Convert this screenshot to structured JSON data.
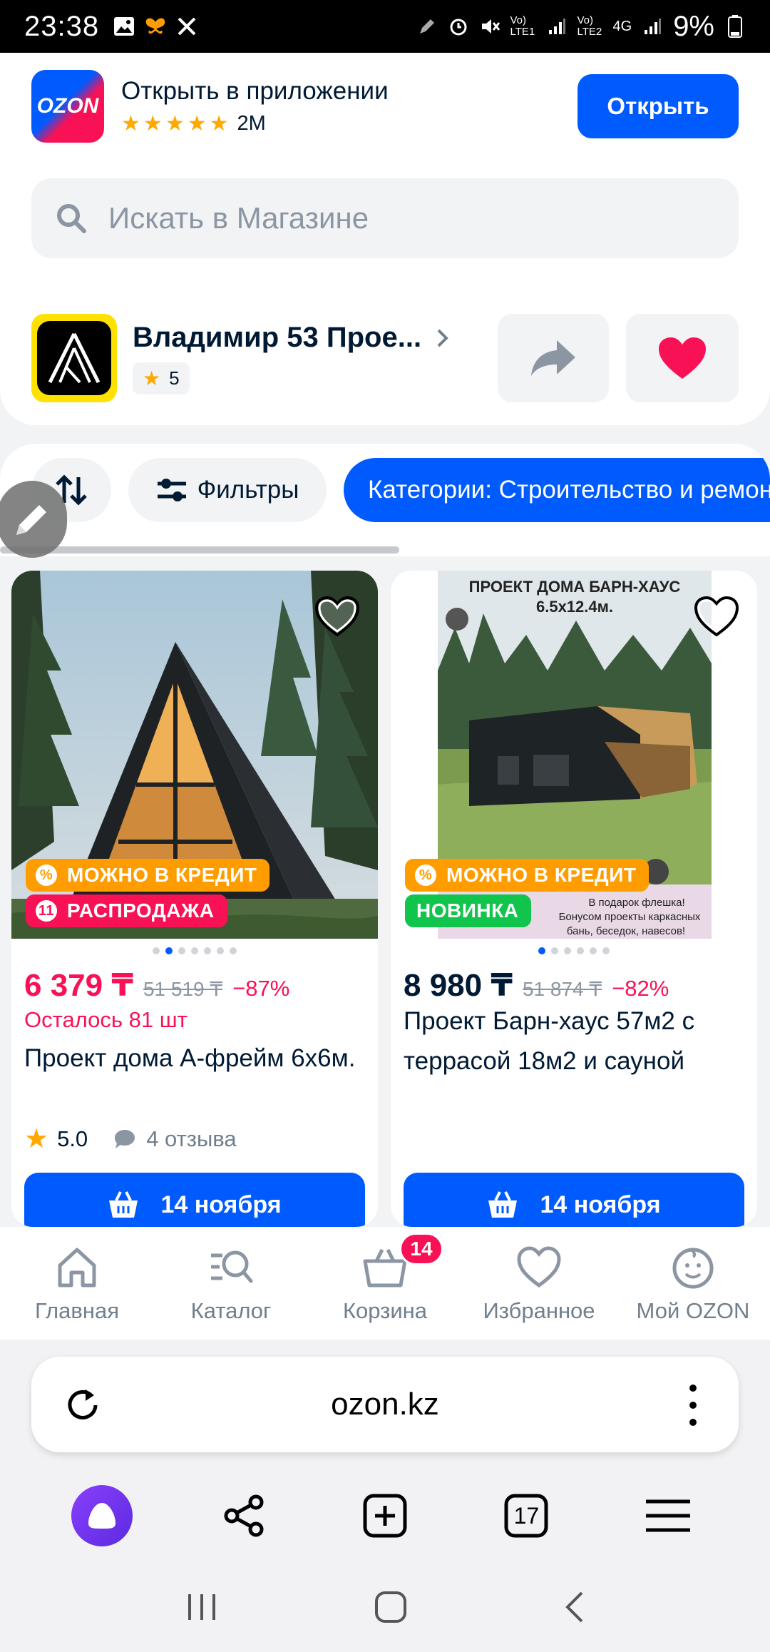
{
  "status_bar": {
    "time": "23:38",
    "network1": "Vo) LTE1",
    "network2": "Vo) LTE2",
    "net_type": "4G",
    "battery": "9%"
  },
  "app_banner": {
    "logo_text": "OZON",
    "title": "Открыть в приложении",
    "rating_stars": 5,
    "reviews": "2M",
    "open_label": "Открыть"
  },
  "search": {
    "placeholder": "Искать в Магазине"
  },
  "seller": {
    "name": "Владимир 53 Прое...",
    "rating": "5"
  },
  "filters": {
    "filters_label": "Фильтры",
    "category_label": "Категории: Строительство и ремонт"
  },
  "products": [
    {
      "badge_credit": "МОЖНО В КРЕДИТ",
      "badge_second": "РАСПРОДАЖА",
      "image_dots": 7,
      "active_dot": 2,
      "price": "6 379 ₸",
      "old_price": "51 519 ₸",
      "discount": "−87%",
      "stock": "Осталось 81 шт",
      "name": "Проект дома А-фрейм 6х6м.",
      "rating": "5.0",
      "reviews": "4 отзыва",
      "delivery": "14 ноября"
    },
    {
      "image_title": "ПРОЕКТ ДОМА БАРН-ХАУС 6.5х12.4м.",
      "image_note": "В подарок флешка! Бонусом проекты каркасных бань, беседок, навесов!",
      "badge_credit": "МОЖНО В КРЕДИТ",
      "badge_second": "НОВИНКА",
      "image_dots": 6,
      "active_dot": 1,
      "price": "8 980 ₸",
      "old_price": "51 874 ₸",
      "discount": "−82%",
      "name": "Проект Барн-хаус 57м2 с террасой 18м2 и сауной",
      "delivery": "14 ноября"
    }
  ],
  "bottom_nav": [
    {
      "label": "Главная",
      "icon": "home-icon"
    },
    {
      "label": "Каталог",
      "icon": "catalog-icon"
    },
    {
      "label": "Корзина",
      "icon": "cart-icon",
      "badge": "14"
    },
    {
      "label": "Избранное",
      "icon": "heart-icon"
    },
    {
      "label": "Мой OZON",
      "icon": "profile-icon"
    }
  ],
  "browser": {
    "url": "ozon.kz",
    "tabs_count": "17"
  },
  "colors": {
    "brand_blue": "#005bff",
    "sale_pink": "#f91155",
    "credit_orange": "#ff9d00",
    "new_green": "#10c44c",
    "star_yellow": "#ffa800"
  }
}
